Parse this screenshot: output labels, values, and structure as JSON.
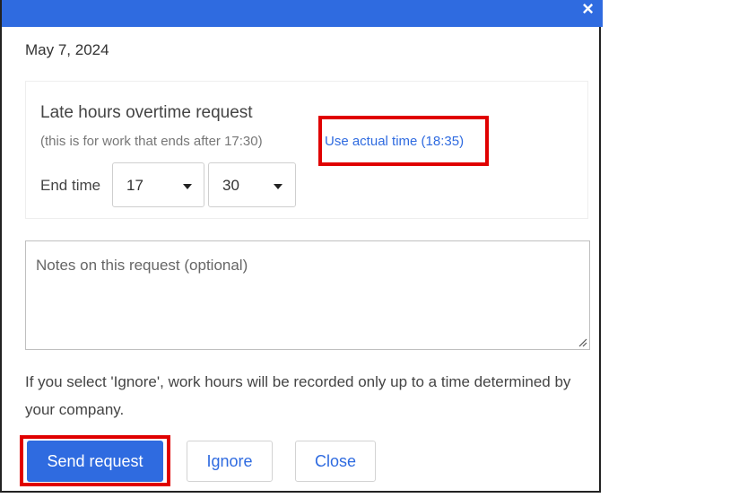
{
  "dialog": {
    "close_icon": "×",
    "date": "May 7, 2024",
    "panel": {
      "title": "Late hours overtime request",
      "subtitle": "(this is for work that ends after 17:30)",
      "actual_time_link": "Use actual time (18:35)",
      "end_time_label": "End time",
      "hour_value": "17",
      "minute_value": "30"
    },
    "notes_placeholder": "Notes on this request (optional)",
    "info_text": "If you select 'Ignore', work hours will be recorded only up to a time determined by your company.",
    "buttons": {
      "send": "Send request",
      "ignore": "Ignore",
      "close": "Close"
    }
  },
  "colors": {
    "accent": "#2f6be0",
    "highlight": "#e00000"
  },
  "icons": [
    "close-icon",
    "chevron-down-icon",
    "resize-grip-icon"
  ]
}
